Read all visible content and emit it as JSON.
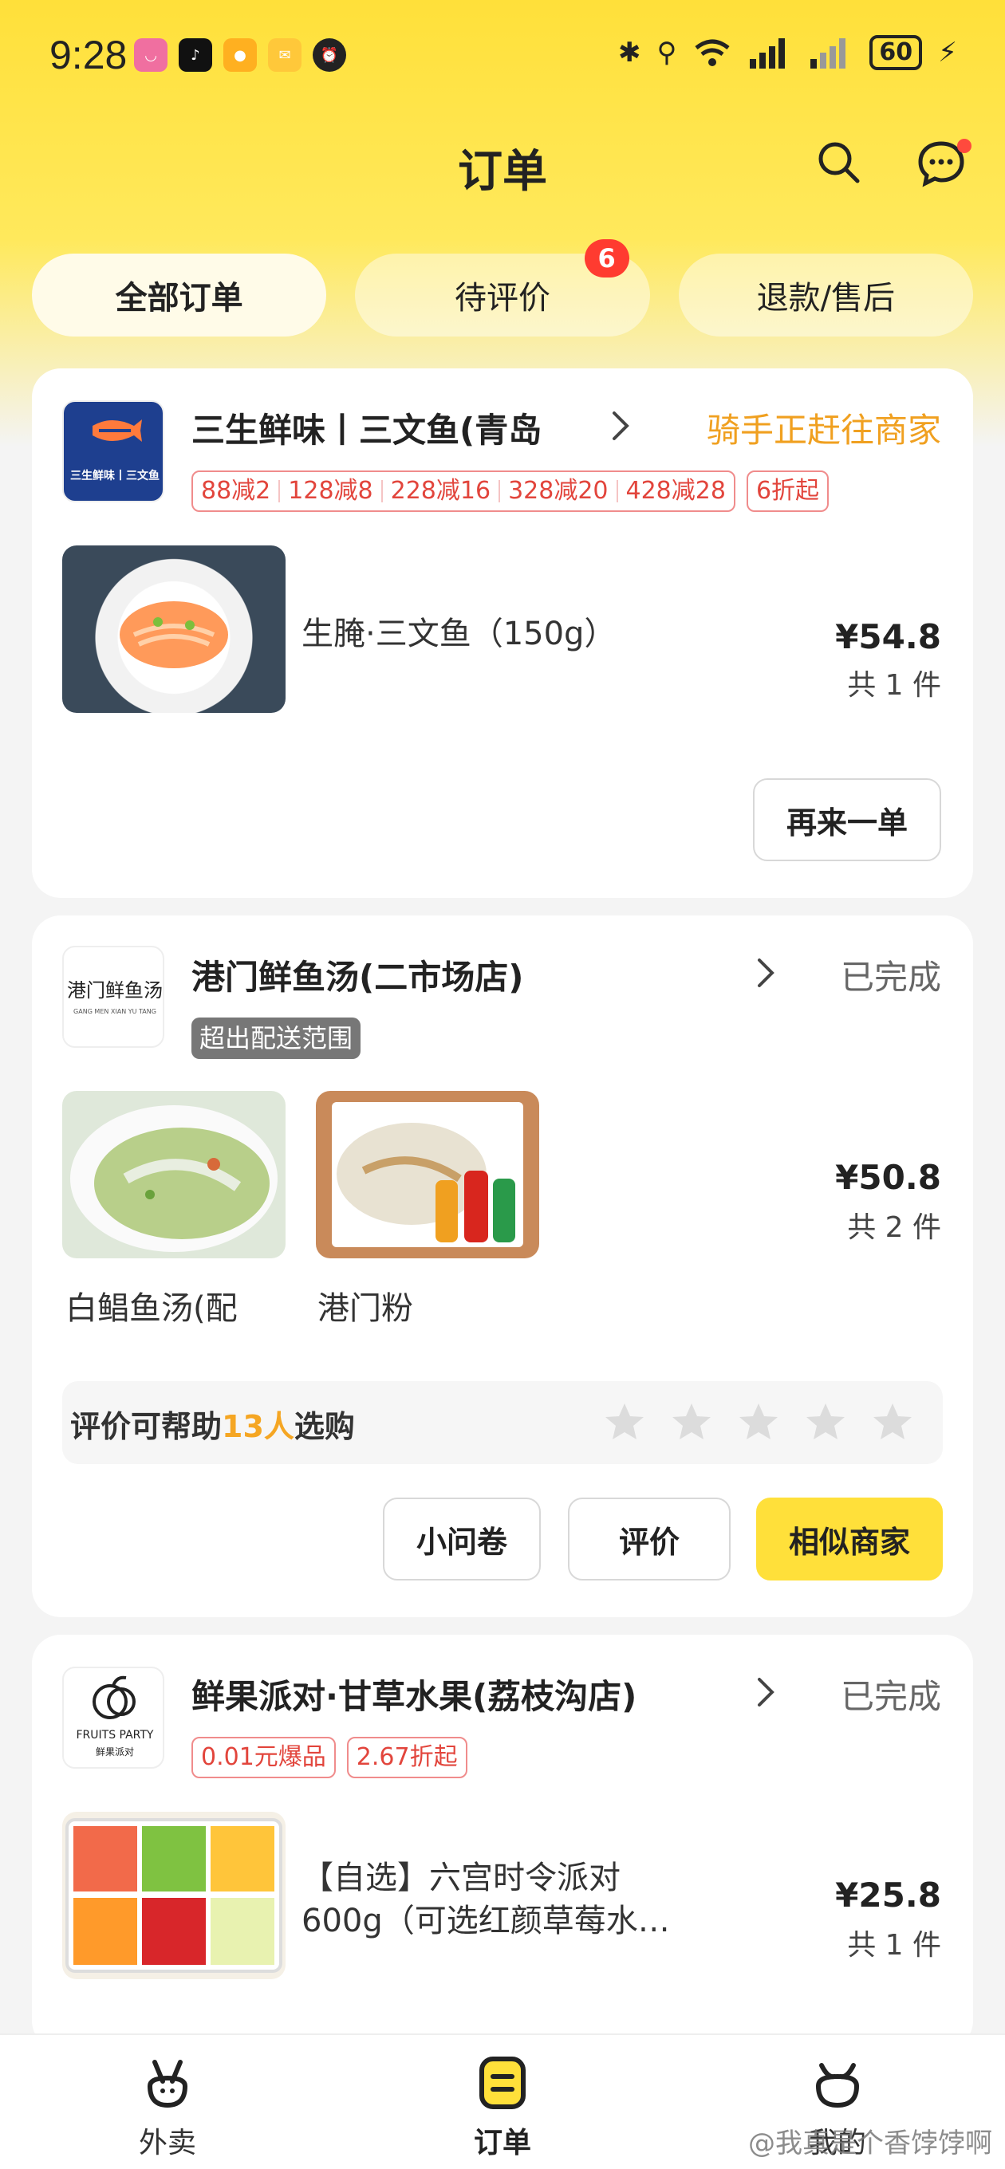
{
  "status_bar": {
    "time": "9:28",
    "battery": "60"
  },
  "header": {
    "title": "订单"
  },
  "tabs": [
    {
      "label": "全部订单",
      "active": true
    },
    {
      "label": "待评价",
      "badge": "6"
    },
    {
      "label": "退款/售后"
    }
  ],
  "orders": [
    {
      "shop_name": "三生鲜味丨三文鱼(青岛",
      "logo_text": "三生鲜味丨三文鱼",
      "status": "骑手正赶往商家",
      "promos": [
        "88减2",
        "128减8",
        "228减16",
        "328减20",
        "428减28"
      ],
      "promo_extra": "6折起",
      "item_name": "生腌·三文鱼（150g）",
      "price": "¥54.8",
      "count": "共 1 件",
      "buttons": [
        "再来一单"
      ]
    },
    {
      "shop_name": "港门鲜鱼汤(二市场店)",
      "logo_text": "港门鲜鱼汤",
      "logo_sub": "GANG MEN XIAN YU TANG",
      "status": "已完成",
      "tag": "超出配送范围",
      "items": [
        "白鲳鱼汤(配",
        "港门粉"
      ],
      "price": "¥50.8",
      "count": "共 2 件",
      "rate_prefix": "评价可帮助",
      "rate_highlight": "13人",
      "rate_suffix": "选购",
      "buttons": [
        "小问卷",
        "评价",
        "相似商家"
      ]
    },
    {
      "shop_name": "鲜果派对·甘草水果(荔枝沟店)",
      "logo_text": "FRUITS PARTY",
      "logo_sub": "鲜果派对",
      "status": "已完成",
      "promos": [
        "0.01元爆品",
        "2.67折起"
      ],
      "item_name_line1": "【自选】六宫时令派对",
      "item_name_line2": "600g（可选红颜草莓水…",
      "price": "¥25.8",
      "count": "共 1 件"
    }
  ],
  "bottom_nav": [
    {
      "label": "外卖",
      "icon": "rabbit-icon"
    },
    {
      "label": "订单",
      "icon": "order-icon",
      "active": true
    },
    {
      "label": "我的",
      "icon": "profile-icon"
    }
  ],
  "watermark": "@我真是个香饽饽啊",
  "colors": {
    "accent": "#ffe03a",
    "promo_red": "#e2453c",
    "status_orange": "#f0a020"
  }
}
